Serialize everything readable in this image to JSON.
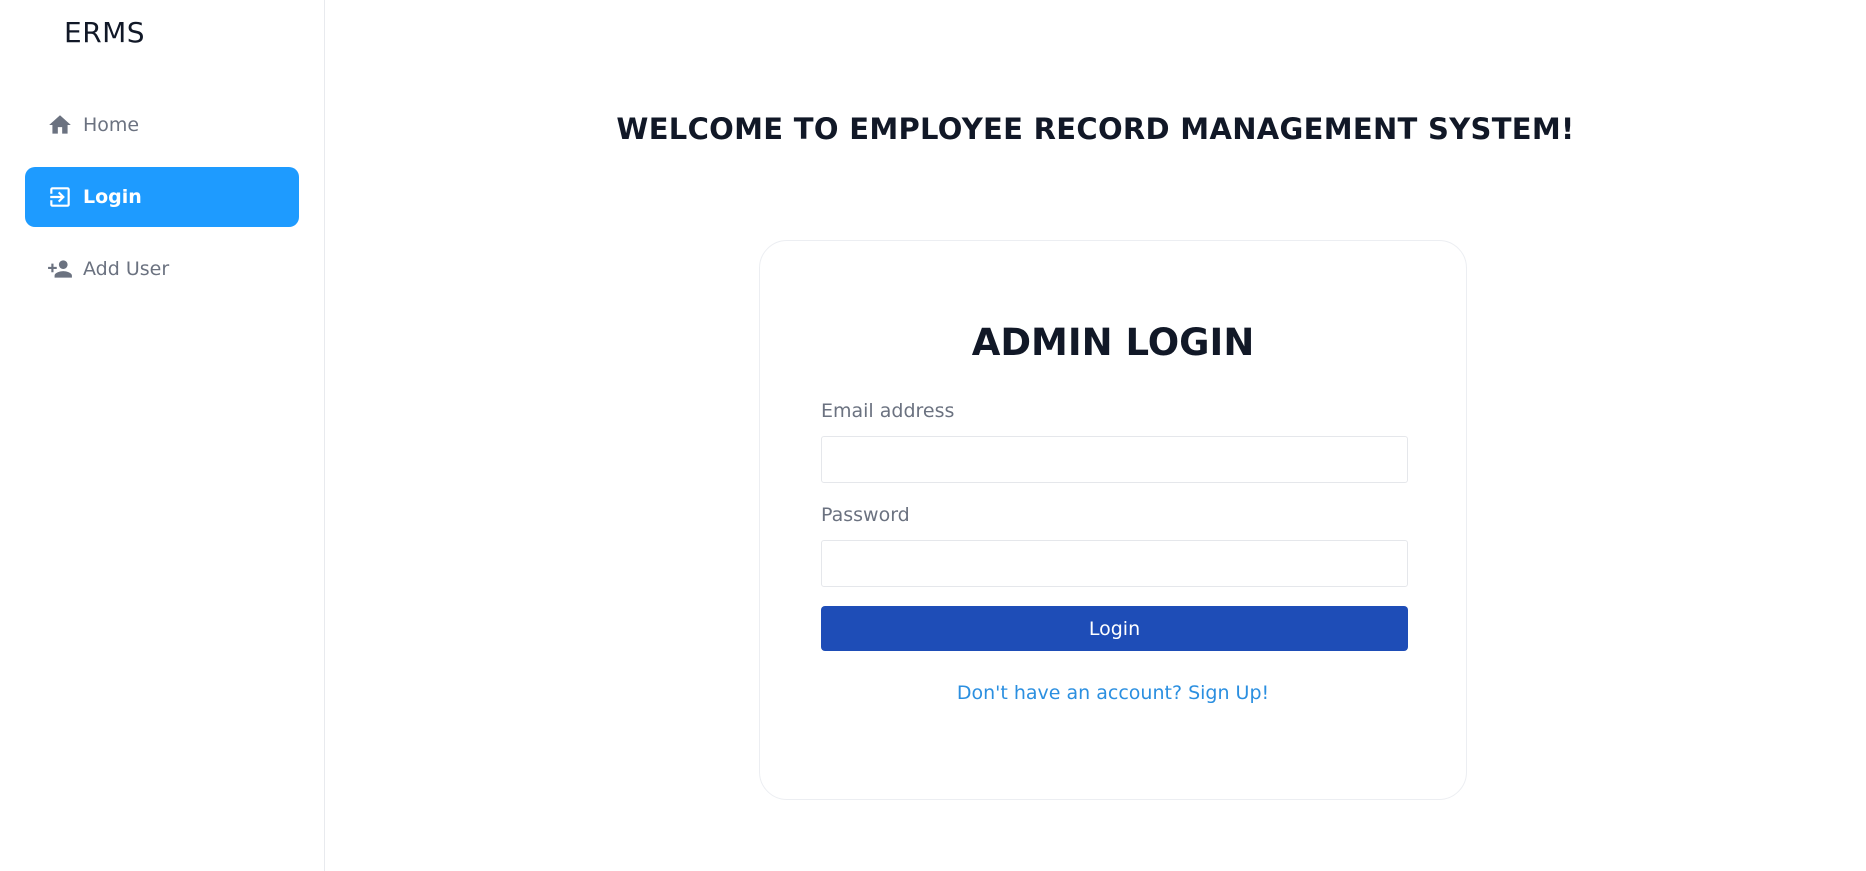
{
  "sidebar": {
    "brand": "ERMS",
    "items": [
      {
        "label": "Home",
        "icon": "home-icon",
        "active": false
      },
      {
        "label": "Login",
        "icon": "login-icon",
        "active": true
      },
      {
        "label": "Add User",
        "icon": "add-user-icon",
        "active": false
      }
    ]
  },
  "main": {
    "welcome": "WELCOME TO EMPLOYEE RECORD MANAGEMENT SYSTEM!",
    "card": {
      "title": "ADMIN LOGIN",
      "email_label": "Email address",
      "email_value": "",
      "password_label": "Password",
      "password_value": "",
      "submit_label": "Login",
      "signup_link": "Don't have an account? Sign Up!"
    }
  },
  "colors": {
    "accent": "#1e9bff",
    "primary_button": "#1e4db7",
    "link": "#2b8fe0",
    "text_dark": "#111827",
    "text_muted": "#6b7280"
  }
}
